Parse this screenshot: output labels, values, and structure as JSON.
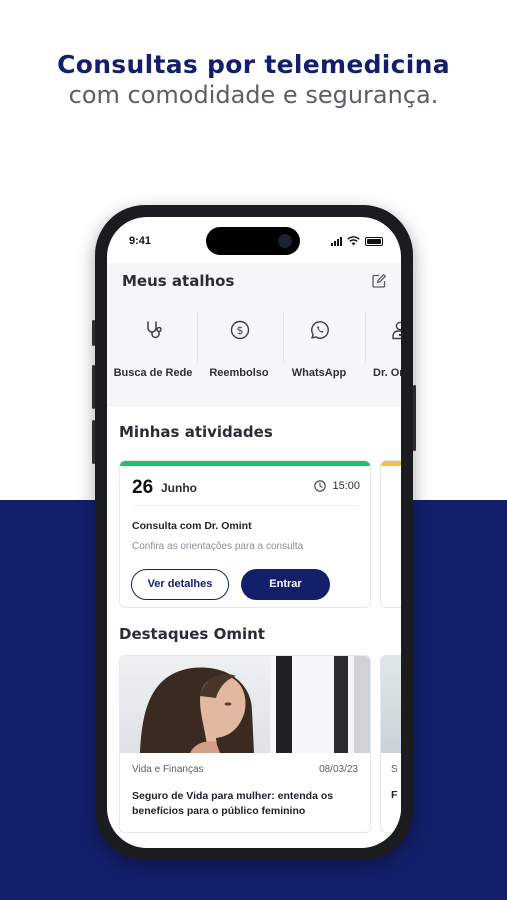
{
  "promo": {
    "headline": "Consultas por telemedicina",
    "subheadline": "com comodidade e segurança."
  },
  "status_bar": {
    "time": "9:41"
  },
  "shortcuts": {
    "title": "Meus atalhos",
    "items": [
      {
        "label": "Busca de Rede",
        "icon": "stethoscope-icon"
      },
      {
        "label": "Reembolso",
        "icon": "dollar-circle-icon"
      },
      {
        "label": "WhatsApp",
        "icon": "whatsapp-icon"
      },
      {
        "label": "Dr. Om",
        "icon": "doctor-icon"
      }
    ]
  },
  "activities": {
    "title": "Minhas atividades",
    "card": {
      "day": "26",
      "month": "Junho",
      "time": "15:00",
      "title": "Consulta com Dr. Omint",
      "subtitle": "Confira as orientações para a consulta",
      "details_button": "Ver detalhes",
      "enter_button": "Entrar"
    }
  },
  "highlights": {
    "title": "Destaques Omint",
    "card": {
      "category": "Vida e Finanças",
      "date": "08/03/23",
      "title": "Seguro de Vida para mulher: entenda os benefícios para o público feminino"
    },
    "peek_category": "S",
    "peek_title": "F"
  },
  "colors": {
    "brand_navy": "#141f6c",
    "activity_accent": "#23c26a",
    "peek_accent": "#f2c14a"
  }
}
